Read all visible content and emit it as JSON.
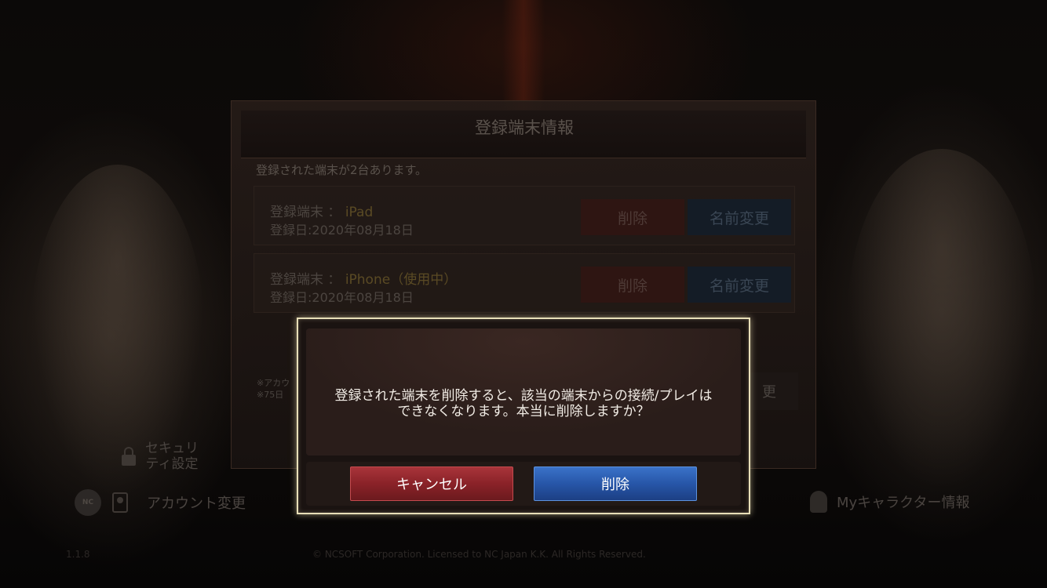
{
  "device_panel": {
    "title": "登録端末情報",
    "count_text": "登録された端末が2台あります。",
    "devices": [
      {
        "label": "登録端末 ：",
        "name": "iPad",
        "date": "登録日:2020年08月18日",
        "delete_label": "削除",
        "rename_label": "名前変更"
      },
      {
        "label": "登録端末 ：",
        "name": "iPhone（使用中）",
        "date": "登録日:2020年08月18日",
        "delete_label": "削除",
        "rename_label": "名前変更"
      }
    ],
    "note_line1": "※アカウ",
    "note_line2": "※75日",
    "change_button_partial": "更"
  },
  "bottom_menu": {
    "security_label": "セキュリティ設定",
    "account_change_label": "アカウント変更",
    "my_character_label": "Myキャラクター情報",
    "ncsoft_logo": "ncsoft-logo"
  },
  "footer": {
    "left_text": "1.1.8",
    "copyright": "© NCSOFT Corporation. Licensed to NC Japan K.K. All Rights Reserved."
  },
  "confirm_dialog": {
    "message_line1": "登録された端末を削除すると、該当の端末からの接続/プレイは",
    "message_line2": "できなくなります。本当に削除しますか？",
    "cancel_label": "キャンセル",
    "delete_label": "削除",
    "colors": {
      "cancel": "#8a2228",
      "delete": "#2756a8",
      "border": "#e8dfb8"
    }
  },
  "icons": {
    "lock": "lock-icon",
    "contact_card": "contact-card-icon",
    "character": "character-icon"
  }
}
